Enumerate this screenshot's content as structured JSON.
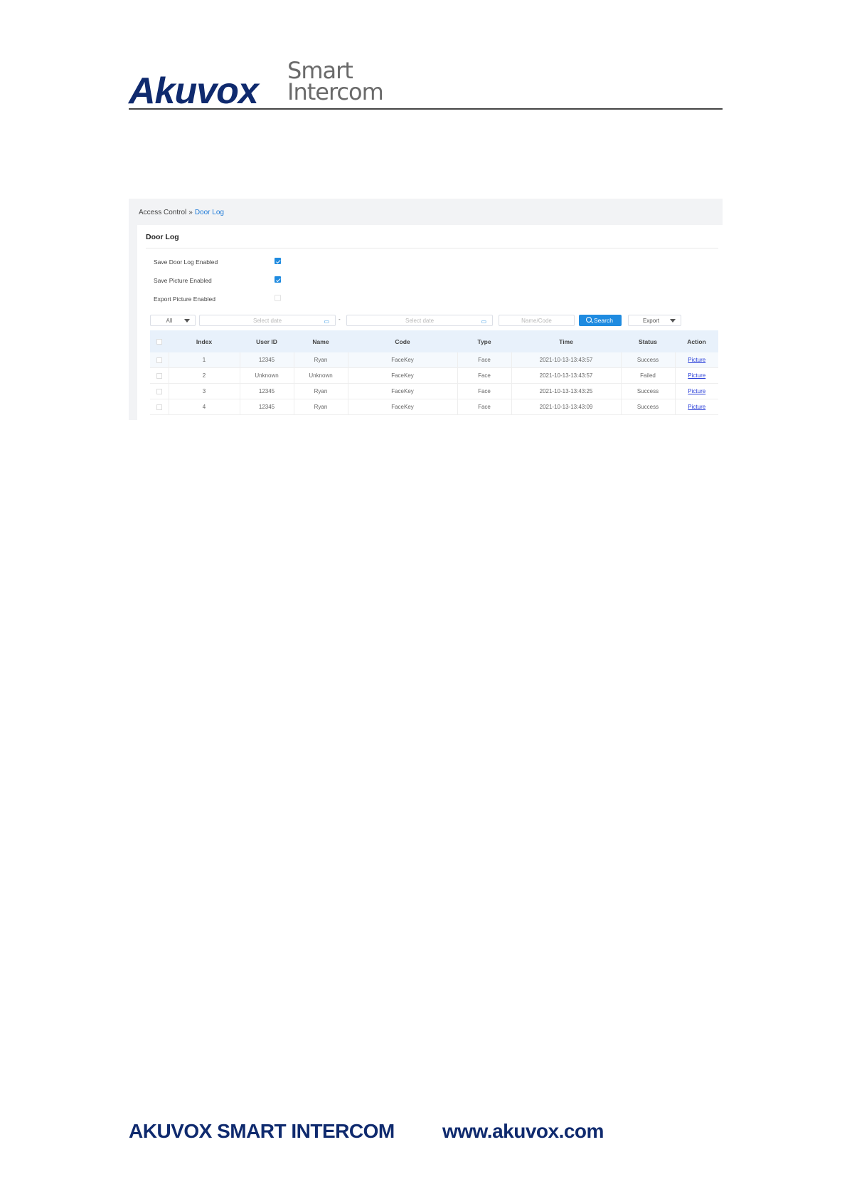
{
  "header": {
    "logo_main": "Akuvox",
    "logo_sub_line1": "Smart",
    "logo_sub_line2": "Intercom"
  },
  "screenshot": {
    "breadcrumb": {
      "parent": "Access Control",
      "separator": "»",
      "current": "Door Log"
    },
    "panel_title": "Door Log",
    "options": [
      {
        "label": "Save Door Log Enabled",
        "checked": true
      },
      {
        "label": "Save Picture Enabled",
        "checked": true
      },
      {
        "label": "Export Picture Enabled",
        "checked": false
      }
    ],
    "filters": {
      "type_select": "All",
      "start_date_placeholder": "Select date",
      "date_separator": "-",
      "end_date_placeholder": "Select date",
      "name_code_placeholder": "Name/Code",
      "search_button": "Search",
      "export_select": "Export"
    },
    "table": {
      "columns": [
        "Index",
        "User ID",
        "Name",
        "Code",
        "Type",
        "Time",
        "Status",
        "Action"
      ],
      "rows": [
        {
          "index": "1",
          "user_id": "12345",
          "name": "Ryan",
          "code": "FaceKey",
          "type": "Face",
          "time": "2021-10-13-13:43:57",
          "status": "Success",
          "action": "Picture"
        },
        {
          "index": "2",
          "user_id": "Unknown",
          "name": "Unknown",
          "code": "FaceKey",
          "type": "Face",
          "time": "2021-10-13-13:43:57",
          "status": "Failed",
          "action": "Picture"
        },
        {
          "index": "3",
          "user_id": "12345",
          "name": "Ryan",
          "code": "FaceKey",
          "type": "Face",
          "time": "2021-10-13-13:43:25",
          "status": "Success",
          "action": "Picture"
        },
        {
          "index": "4",
          "user_id": "12345",
          "name": "Ryan",
          "code": "FaceKey",
          "type": "Face",
          "time": "2021-10-13-13:43:09",
          "status": "Success",
          "action": "Picture"
        }
      ]
    }
  },
  "footer": {
    "company": "AKUVOX SMART INTERCOM",
    "website": "www.akuvox.com"
  },
  "colors": {
    "brand_navy": "#0f2a6e",
    "accent_blue": "#1f8be0",
    "link_blue": "#2a3fd8"
  }
}
